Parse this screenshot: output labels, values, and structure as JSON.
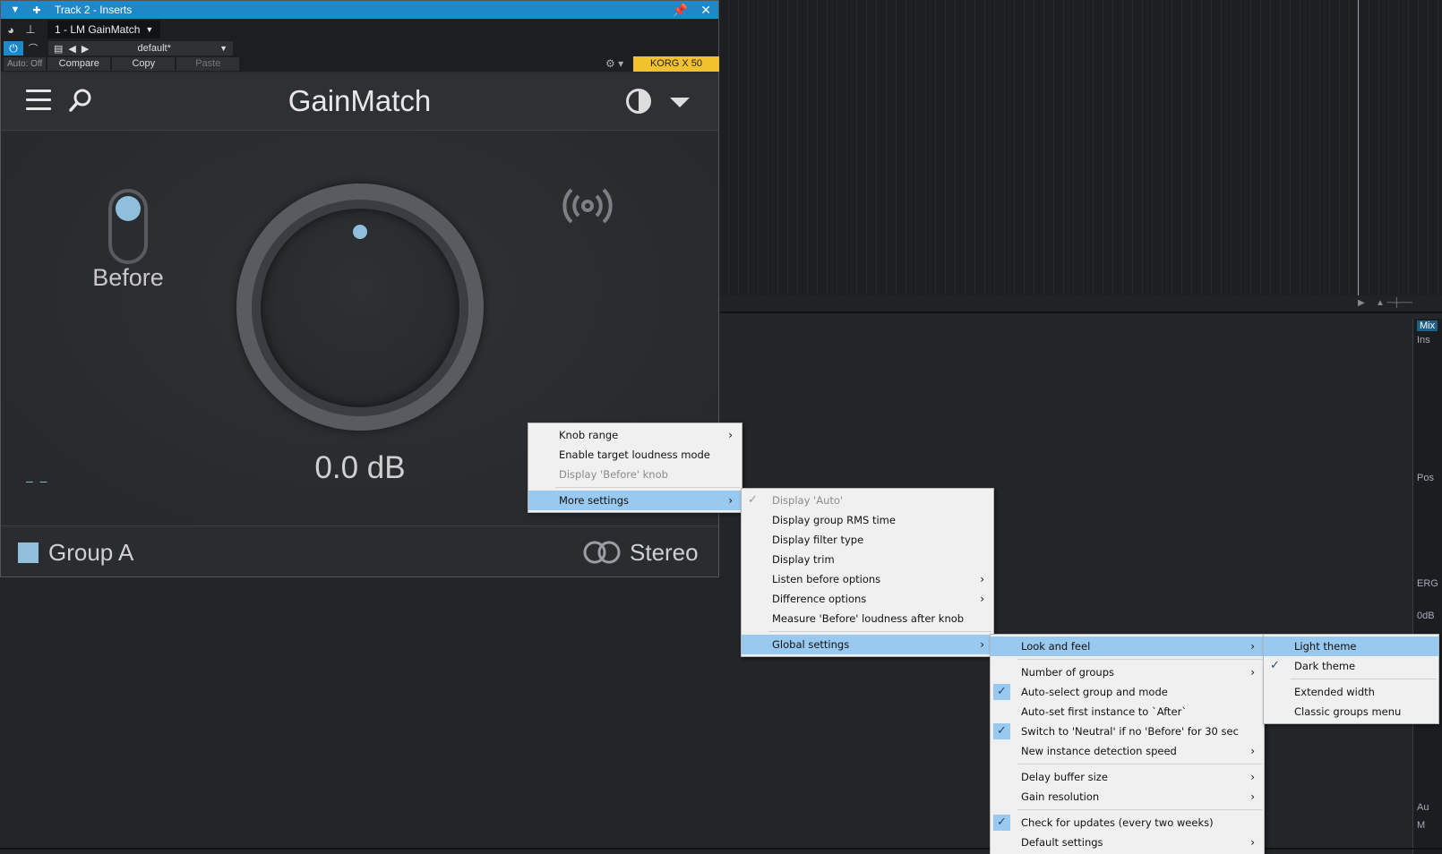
{
  "window": {
    "title": "Track 2 - Inserts",
    "insert_name": "1 - LM GainMatch",
    "preset_name": "default*",
    "auto_label": "Auto: Off",
    "compare_label": "Compare",
    "copy_label": "Copy",
    "paste_label": "Paste",
    "device_label": "KORG X 50"
  },
  "plugin": {
    "title": "GainMatch",
    "before_label": "Before",
    "knob_value": "0.0 dB",
    "dash_label": "– –",
    "group_label": "Group A",
    "stereo_label": "Stereo",
    "accent_color": "#8fbfdc"
  },
  "mixer_strip": {
    "labels": [
      "Mix",
      "Ins",
      "Pos",
      "ERG",
      "0dB",
      "Au",
      "M"
    ]
  },
  "menus": {
    "main": [
      {
        "label": "Knob range",
        "submenu": true
      },
      {
        "label": "Enable target loudness mode"
      },
      {
        "label": "Display 'Before' knob",
        "disabled": true
      },
      {
        "label": "More settings",
        "submenu": true,
        "selected": true
      }
    ],
    "more_settings": [
      {
        "label": "Display 'Auto'",
        "disabled": true,
        "checked": true
      },
      {
        "label": "Display group RMS time"
      },
      {
        "label": "Display filter type"
      },
      {
        "label": "Display trim"
      },
      {
        "label": "Listen before options",
        "submenu": true
      },
      {
        "label": "Difference options",
        "submenu": true
      },
      {
        "label": "Measure 'Before' loudness after knob"
      },
      {
        "label": "Global settings",
        "submenu": true,
        "selected": true
      }
    ],
    "global_settings": [
      {
        "label": "Look and feel",
        "submenu": true,
        "selected": true
      },
      {
        "label": "Number of groups",
        "submenu": true
      },
      {
        "label": "Auto-select group and mode",
        "checked": true
      },
      {
        "label": "Auto-set first instance to `After`"
      },
      {
        "label": "Switch to 'Neutral' if no 'Before' for 30 sec",
        "checked": true
      },
      {
        "label": "New instance detection speed",
        "submenu": true
      },
      {
        "label": "Delay buffer size",
        "submenu": true
      },
      {
        "label": "Gain resolution",
        "submenu": true
      },
      {
        "label": "Check for updates (every two weeks)",
        "checked": true
      },
      {
        "label": "Default settings",
        "submenu": true
      }
    ],
    "look_and_feel": [
      {
        "label": "Light theme",
        "selected": true
      },
      {
        "label": "Dark theme",
        "checked": true
      },
      {
        "label": "Extended width"
      },
      {
        "label": "Classic groups menu"
      }
    ]
  }
}
